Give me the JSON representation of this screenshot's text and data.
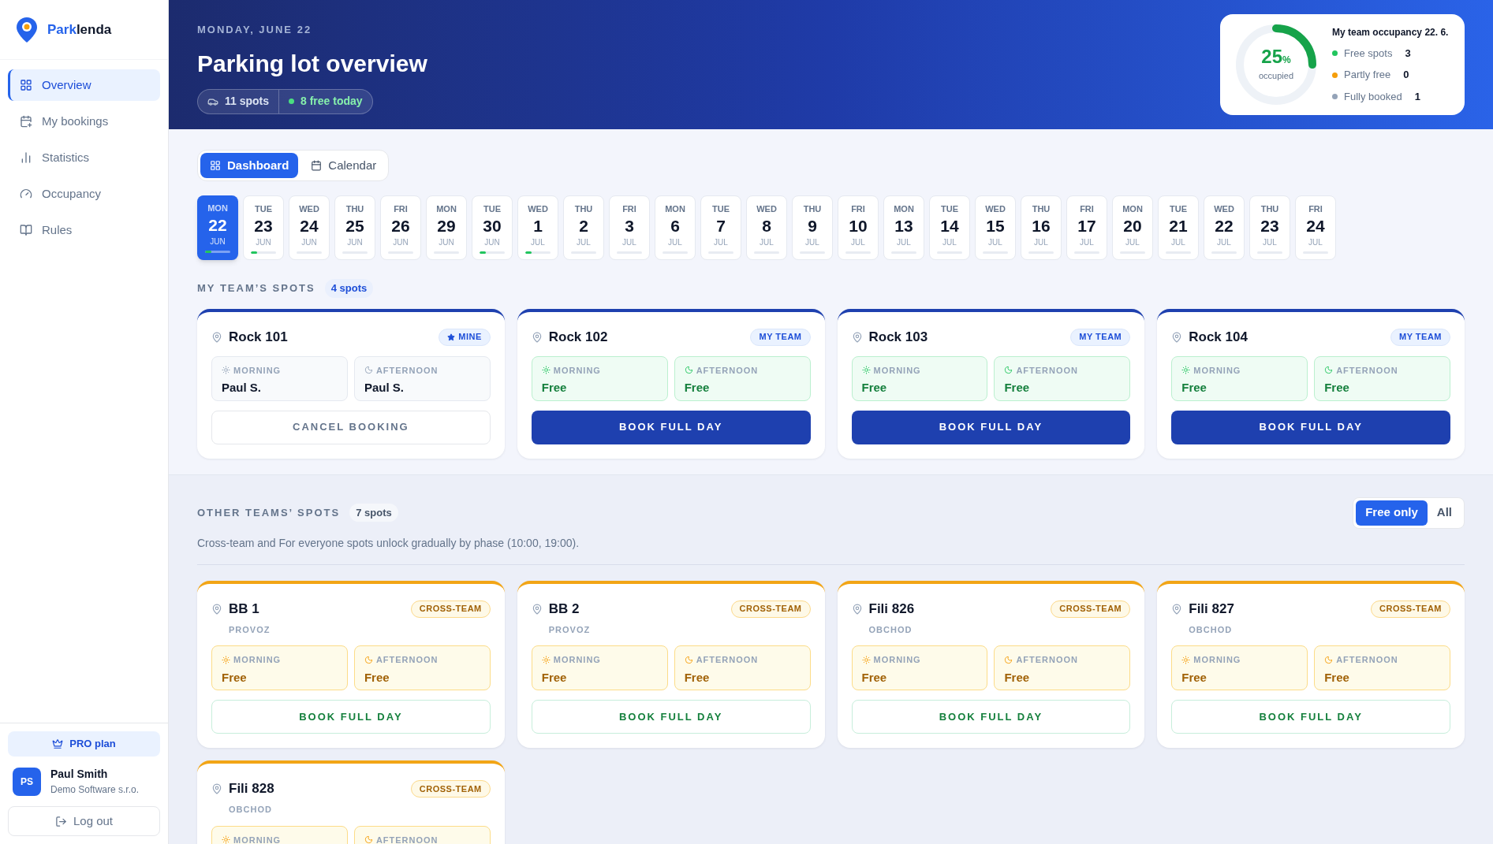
{
  "sidebar": {
    "brand": {
      "first": "Park",
      "second": "lenda"
    },
    "items": [
      {
        "label": "Overview",
        "kind": "grid",
        "selected": true
      },
      {
        "label": "My bookings",
        "kind": "calendar",
        "selected": false
      },
      {
        "label": "Statistics",
        "kind": "chart",
        "selected": false
      },
      {
        "label": "Occupancy",
        "kind": "gauge",
        "selected": false
      },
      {
        "label": "Rules",
        "kind": "book",
        "selected": false
      }
    ],
    "plan": "PRO plan",
    "user": {
      "initials": "PS",
      "name": "Paul Smith",
      "company": "Demo Software s.r.o."
    },
    "logout": "Log out"
  },
  "header": {
    "date": "MONDAY, JUNE 22",
    "title": "Parking lot overview",
    "spots": "11 spots",
    "free_today": "8 free today",
    "occupancy": {
      "title": "My team occupancy 22. 6.",
      "value": "25",
      "unit": "%",
      "caption": "occupied",
      "level": 0.25,
      "legend": [
        {
          "label": "Free spots",
          "count": "3",
          "color": "#22c55e"
        },
        {
          "label": "Partly free",
          "count": "0",
          "color": "#f59e0b"
        },
        {
          "label": "Fully booked",
          "count": "1",
          "color": "#94a3b8"
        }
      ]
    }
  },
  "views": [
    {
      "label": "Dashboard",
      "kind": "grid",
      "selected": true
    },
    {
      "label": "Calendar",
      "kind": "calendar",
      "selected": false
    }
  ],
  "dates": [
    {
      "day": "MON",
      "num": "22",
      "month": "JUN",
      "level": 0.25,
      "selected": true
    },
    {
      "day": "TUE",
      "num": "23",
      "month": "JUN",
      "level": 0.25,
      "selected": false
    },
    {
      "day": "WED",
      "num": "24",
      "month": "JUN",
      "selected": false
    },
    {
      "day": "THU",
      "num": "25",
      "month": "JUN",
      "selected": false
    },
    {
      "day": "FRI",
      "num": "26",
      "month": "JUN",
      "selected": false
    },
    {
      "day": "MON",
      "num": "29",
      "month": "JUN",
      "selected": false
    },
    {
      "day": "TUE",
      "num": "30",
      "month": "JUN",
      "level": 0.25,
      "selected": false
    },
    {
      "day": "WED",
      "num": "1",
      "month": "JUL",
      "level": 0.25,
      "selected": false
    },
    {
      "day": "THU",
      "num": "2",
      "month": "JUL",
      "selected": false
    },
    {
      "day": "FRI",
      "num": "3",
      "month": "JUL",
      "selected": false
    },
    {
      "day": "MON",
      "num": "6",
      "month": "JUL",
      "selected": false
    },
    {
      "day": "TUE",
      "num": "7",
      "month": "JUL",
      "selected": false
    },
    {
      "day": "WED",
      "num": "8",
      "month": "JUL",
      "selected": false
    },
    {
      "day": "THU",
      "num": "9",
      "month": "JUL",
      "selected": false
    },
    {
      "day": "FRI",
      "num": "10",
      "month": "JUL",
      "selected": false
    },
    {
      "day": "MON",
      "num": "13",
      "month": "JUL",
      "selected": false
    },
    {
      "day": "TUE",
      "num": "14",
      "month": "JUL",
      "selected": false
    },
    {
      "day": "WED",
      "num": "15",
      "month": "JUL",
      "selected": false
    },
    {
      "day": "THU",
      "num": "16",
      "month": "JUL",
      "selected": false
    },
    {
      "day": "FRI",
      "num": "17",
      "month": "JUL",
      "selected": false
    },
    {
      "day": "MON",
      "num": "20",
      "month": "JUL",
      "selected": false
    },
    {
      "day": "TUE",
      "num": "21",
      "month": "JUL",
      "selected": false
    },
    {
      "day": "WED",
      "num": "22",
      "month": "JUL",
      "selected": false
    },
    {
      "day": "THU",
      "num": "23",
      "month": "JUL",
      "selected": false
    },
    {
      "day": "FRI",
      "num": "24",
      "month": "JUL",
      "selected": false
    }
  ],
  "my_team": {
    "title": "MY TEAM’S SPOTS",
    "count": "4 spots",
    "spots": [
      {
        "name": "Rock 101",
        "kind": "team",
        "badge": {
          "label": "MINE",
          "kind": "mine"
        },
        "slots": [
          {
            "label": "MORNING",
            "kind": "morning",
            "value": "Paul S.",
            "free": false
          },
          {
            "label": "AFTERNOON",
            "kind": "afternoon",
            "value": "Paul S.",
            "free": false
          }
        ],
        "action": {
          "label": "CANCEL BOOKING",
          "kind": "cancel"
        }
      },
      {
        "name": "Rock 102",
        "kind": "team",
        "badge": {
          "label": "MY TEAM",
          "kind": "team"
        },
        "slots": [
          {
            "label": "MORNING",
            "kind": "morning",
            "value": "Free",
            "free": true
          },
          {
            "label": "AFTERNOON",
            "kind": "afternoon",
            "value": "Free",
            "free": true
          }
        ],
        "action": {
          "label": "BOOK FULL DAY",
          "kind": "book"
        }
      },
      {
        "name": "Rock 103",
        "kind": "team",
        "badge": {
          "label": "MY TEAM",
          "kind": "team"
        },
        "slots": [
          {
            "label": "MORNING",
            "kind": "morning",
            "value": "Free",
            "free": true
          },
          {
            "label": "AFTERNOON",
            "kind": "afternoon",
            "value": "Free",
            "free": true
          }
        ],
        "action": {
          "label": "BOOK FULL DAY",
          "kind": "book"
        }
      },
      {
        "name": "Rock 104",
        "kind": "team",
        "badge": {
          "label": "MY TEAM",
          "kind": "team"
        },
        "slots": [
          {
            "label": "MORNING",
            "kind": "morning",
            "value": "Free",
            "free": true
          },
          {
            "label": "AFTERNOON",
            "kind": "afternoon",
            "value": "Free",
            "free": true
          }
        ],
        "action": {
          "label": "BOOK FULL DAY",
          "kind": "book"
        }
      }
    ]
  },
  "other_teams": {
    "title": "OTHER TEAMS’ SPOTS",
    "count": "7 spots",
    "filters": [
      {
        "label": "Free only",
        "selected": true
      },
      {
        "label": "All",
        "selected": false
      }
    ],
    "note": "Cross-team and For everyone spots unlock gradually by phase (10:00, 19:00).",
    "spots": [
      {
        "name": "BB 1",
        "group": "PROVOZ",
        "kind": "cross",
        "badge": {
          "label": "CROSS-TEAM",
          "kind": "cross"
        },
        "slots": [
          {
            "label": "MORNING",
            "kind": "morning",
            "value": "Free",
            "free": true
          },
          {
            "label": "AFTERNOON",
            "kind": "afternoon",
            "value": "Free",
            "free": true
          }
        ],
        "action": {
          "label": "BOOK FULL DAY",
          "kind": "book"
        }
      },
      {
        "name": "BB 2",
        "group": "PROVOZ",
        "kind": "cross",
        "badge": {
          "label": "CROSS-TEAM",
          "kind": "cross"
        },
        "slots": [
          {
            "label": "MORNING",
            "kind": "morning",
            "value": "Free",
            "free": true
          },
          {
            "label": "AFTERNOON",
            "kind": "afternoon",
            "value": "Free",
            "free": true
          }
        ],
        "action": {
          "label": "BOOK FULL DAY",
          "kind": "book"
        }
      },
      {
        "name": "Fili 826",
        "group": "OBCHOD",
        "kind": "cross",
        "badge": {
          "label": "CROSS-TEAM",
          "kind": "cross"
        },
        "slots": [
          {
            "label": "MORNING",
            "kind": "morning",
            "value": "Free",
            "free": true
          },
          {
            "label": "AFTERNOON",
            "kind": "afternoon",
            "value": "Free",
            "free": true
          }
        ],
        "action": {
          "label": "BOOK FULL DAY",
          "kind": "book"
        }
      },
      {
        "name": "Fili 827",
        "group": "OBCHOD",
        "kind": "cross",
        "badge": {
          "label": "CROSS-TEAM",
          "kind": "cross"
        },
        "slots": [
          {
            "label": "MORNING",
            "kind": "morning",
            "value": "Free",
            "free": true
          },
          {
            "label": "AFTERNOON",
            "kind": "afternoon",
            "value": "Free",
            "free": true
          }
        ],
        "action": {
          "label": "BOOK FULL DAY",
          "kind": "book"
        }
      },
      {
        "name": "Fili 828",
        "group": "OBCHOD",
        "kind": "cross",
        "badge": {
          "label": "CROSS-TEAM",
          "kind": "cross"
        },
        "slots": [
          {
            "label": "MORNING",
            "kind": "morning",
            "free": true
          },
          {
            "label": "AFTERNOON",
            "kind": "afternoon",
            "free": true
          }
        ]
      }
    ]
  }
}
